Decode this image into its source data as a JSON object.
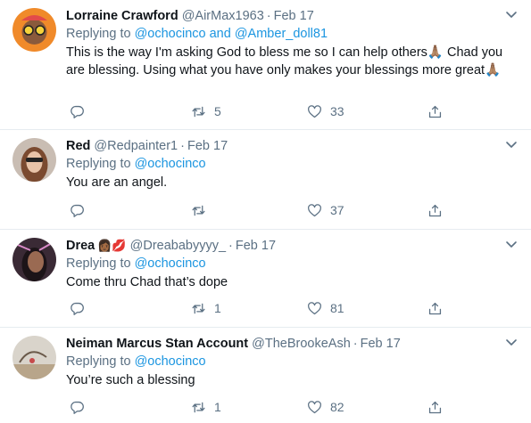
{
  "tweets": [
    {
      "name": "Lorraine Crawford",
      "emoji": "",
      "handle": "@AirMax1963",
      "dot": "·",
      "date": "Feb 17",
      "replying_prefix": "Replying to",
      "replying_to": "@ochocinco and @Amber_doll81",
      "text": "This is the way I'm asking God to bless me so I can help others🙏🏽 Chad you are blessing. Using what you have only makes your blessings more great🙏🏽",
      "replies": "",
      "retweets": "5",
      "likes": "33",
      "avatar_bg": "#f08a2a"
    },
    {
      "name": "Red",
      "emoji": "",
      "handle": "@Redpainter1",
      "dot": "·",
      "date": "Feb 17",
      "replying_prefix": "Replying to",
      "replying_to": "@ochocinco",
      "text": "You are an angel.",
      "replies": "",
      "retweets": "",
      "likes": "37",
      "avatar_bg": "#c9bdb3"
    },
    {
      "name": "Drea",
      "emoji": "👩🏾💋",
      "handle": "@Dreababyyyy_",
      "dot": "·",
      "date": "Feb 17",
      "replying_prefix": "Replying to",
      "replying_to": "@ochocinco",
      "text": "Come thru Chad that’s dope",
      "replies": "",
      "retweets": "1",
      "likes": "81",
      "avatar_bg": "#3a2a35"
    },
    {
      "name": "Neiman Marcus Stan Account",
      "emoji": "",
      "handle": "@TheBrookeAsh",
      "dot": "·",
      "date": "Feb 17",
      "replying_prefix": "Replying to",
      "replying_to": "@ochocinco",
      "text": "You’re such a blessing",
      "replies": "",
      "retweets": "1",
      "likes": "82",
      "avatar_bg": "#d9d4cb"
    }
  ],
  "colors": {
    "link": "#1b95e0",
    "muted": "#5b7083",
    "divider": "#e6ecf0"
  },
  "icons": [
    "reply-icon",
    "retweet-icon",
    "like-icon",
    "share-icon",
    "chevron-down-icon"
  ]
}
